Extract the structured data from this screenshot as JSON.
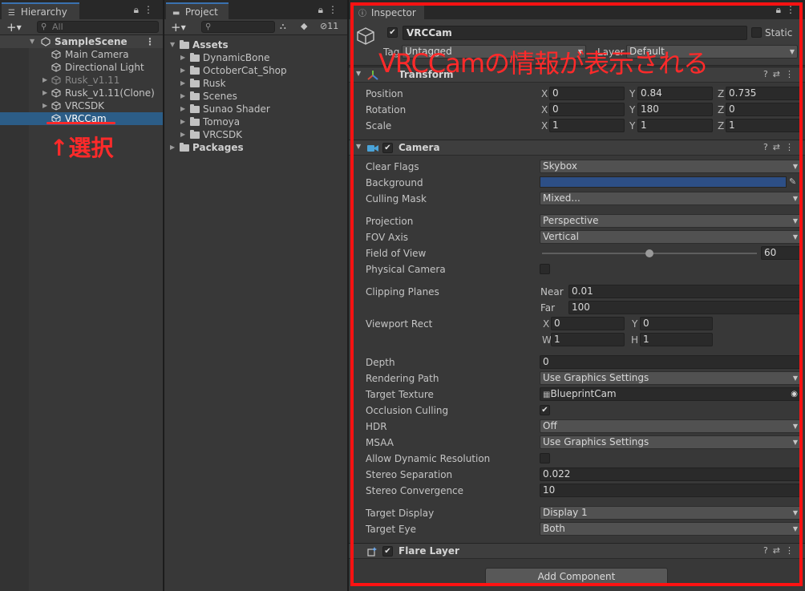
{
  "hierarchy": {
    "tab_label": "Hierarchy",
    "search_placeholder": "All",
    "scene": "SampleScene",
    "items": [
      {
        "label": "Main Camera"
      },
      {
        "label": "Directional Light"
      },
      {
        "label": "Rusk_v1.11"
      },
      {
        "label": "Rusk_v1.11(Clone)"
      },
      {
        "label": "VRCSDK"
      },
      {
        "label": "VRCCam"
      }
    ]
  },
  "project": {
    "tab_label": "Project",
    "hidden_count": "11",
    "assets_label": "Assets",
    "folders": [
      "DynamicBone",
      "OctoberCat_Shop",
      "Rusk",
      "Scenes",
      "Sunao Shader",
      "Tomoya",
      "VRCSDK"
    ],
    "packages_label": "Packages"
  },
  "inspector": {
    "tab_label": "Inspector",
    "object_name": "VRCCam",
    "static_label": "Static",
    "tag_label": "Tag",
    "tag_value": "Untagged",
    "layer_label": "Layer",
    "layer_value": "Default",
    "transform": {
      "title": "Transform",
      "position_label": "Position",
      "rotation_label": "Rotation",
      "scale_label": "Scale",
      "axis_x": "X",
      "axis_y": "Y",
      "axis_z": "Z",
      "position": {
        "x": "0",
        "y": "0.84",
        "z": "0.735"
      },
      "rotation": {
        "x": "0",
        "y": "180",
        "z": "0"
      },
      "scale": {
        "x": "1",
        "y": "1",
        "z": "1"
      }
    },
    "camera": {
      "title": "Camera",
      "clear_flags_label": "Clear Flags",
      "clear_flags": "Skybox",
      "background_label": "Background",
      "background_color": "#2d4f86",
      "culling_mask_label": "Culling Mask",
      "culling_mask": "Mixed...",
      "projection_label": "Projection",
      "projection": "Perspective",
      "fov_axis_label": "FOV Axis",
      "fov_axis": "Vertical",
      "fov_label": "Field of View",
      "fov": "60",
      "fov_fraction": 0.5,
      "physical_label": "Physical Camera",
      "clipping_label": "Clipping Planes",
      "near_label": "Near",
      "near": "0.01",
      "far_label": "Far",
      "far": "100",
      "viewport_label": "Viewport Rect",
      "vp_x_label": "X",
      "vp_x": "0",
      "vp_y_label": "Y",
      "vp_y": "0",
      "vp_w_label": "W",
      "vp_w": "1",
      "vp_h_label": "H",
      "vp_h": "1",
      "depth_label": "Depth",
      "depth": "0",
      "rendering_path_label": "Rendering Path",
      "rendering_path": "Use Graphics Settings",
      "target_texture_label": "Target Texture",
      "target_texture": "BlueprintCam",
      "occlusion_label": "Occlusion Culling",
      "hdr_label": "HDR",
      "hdr": "Off",
      "msaa_label": "MSAA",
      "msaa": "Use Graphics Settings",
      "dyn_res_label": "Allow Dynamic Resolution",
      "stereo_sep_label": "Stereo Separation",
      "stereo_sep": "0.022",
      "stereo_conv_label": "Stereo Convergence",
      "stereo_conv": "10",
      "target_display_label": "Target Display",
      "target_display": "Display 1",
      "target_eye_label": "Target Eye",
      "target_eye": "Both"
    },
    "flare": {
      "title": "Flare Layer"
    },
    "add_component": "Add Component"
  },
  "annotations": {
    "inspector_note": "VRCCamの情報が表示される",
    "select_note": "↑選択",
    "color": "#ff1212"
  }
}
